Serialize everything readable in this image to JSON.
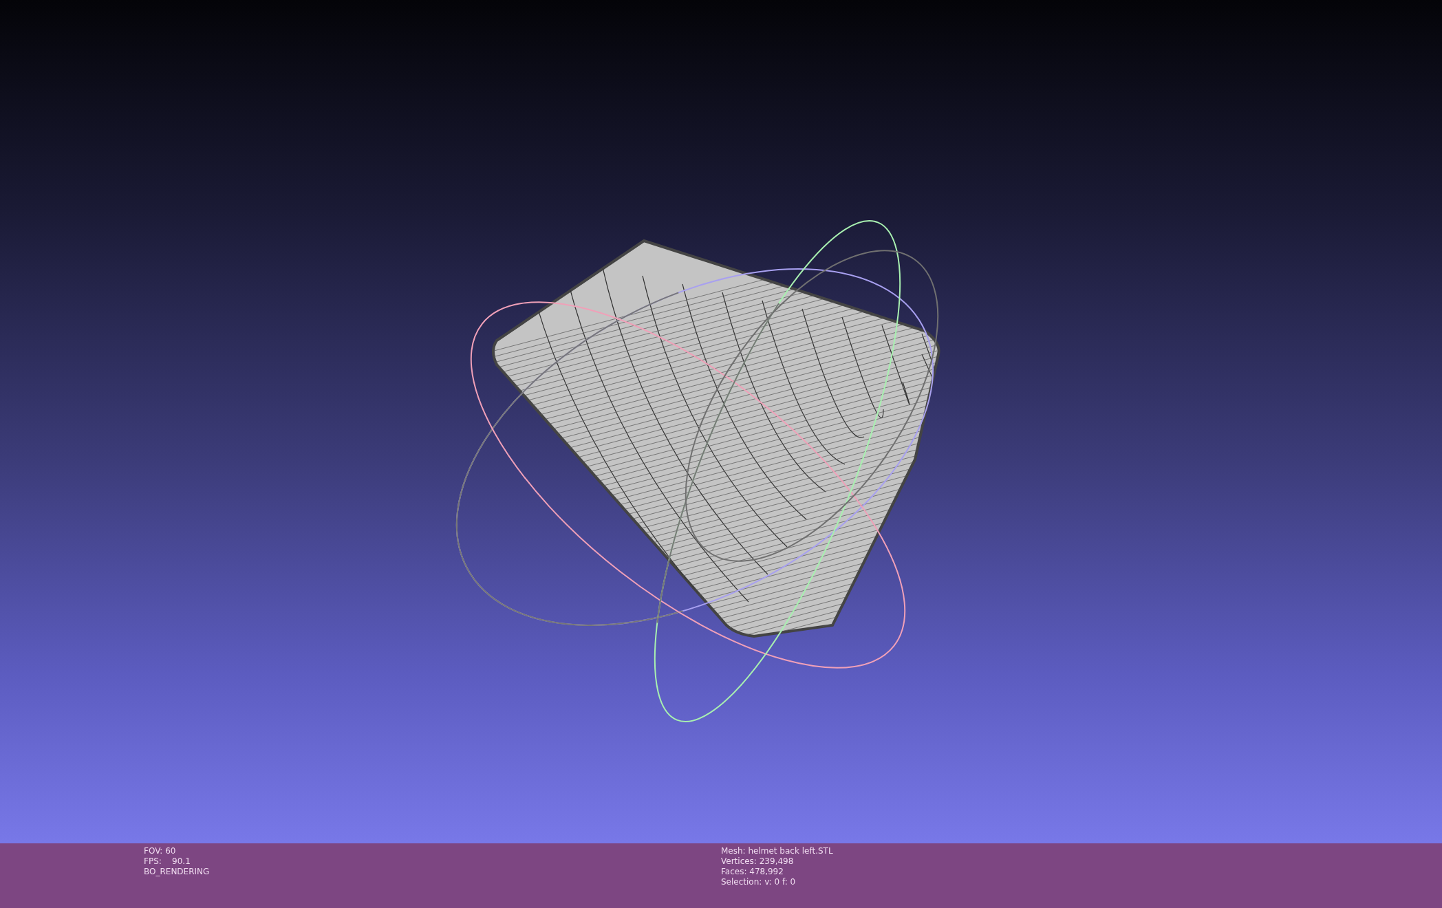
{
  "status_bar": {
    "left_info": [
      "FOV: 60",
      "FPS:    90.1",
      "BO_RENDERING"
    ],
    "right_info": [
      "Mesh: helmet back left.STL",
      "Vertices: 239,498",
      "Faces: 478,992",
      "Selection: v: 0 f: 0"
    ]
  }
}
